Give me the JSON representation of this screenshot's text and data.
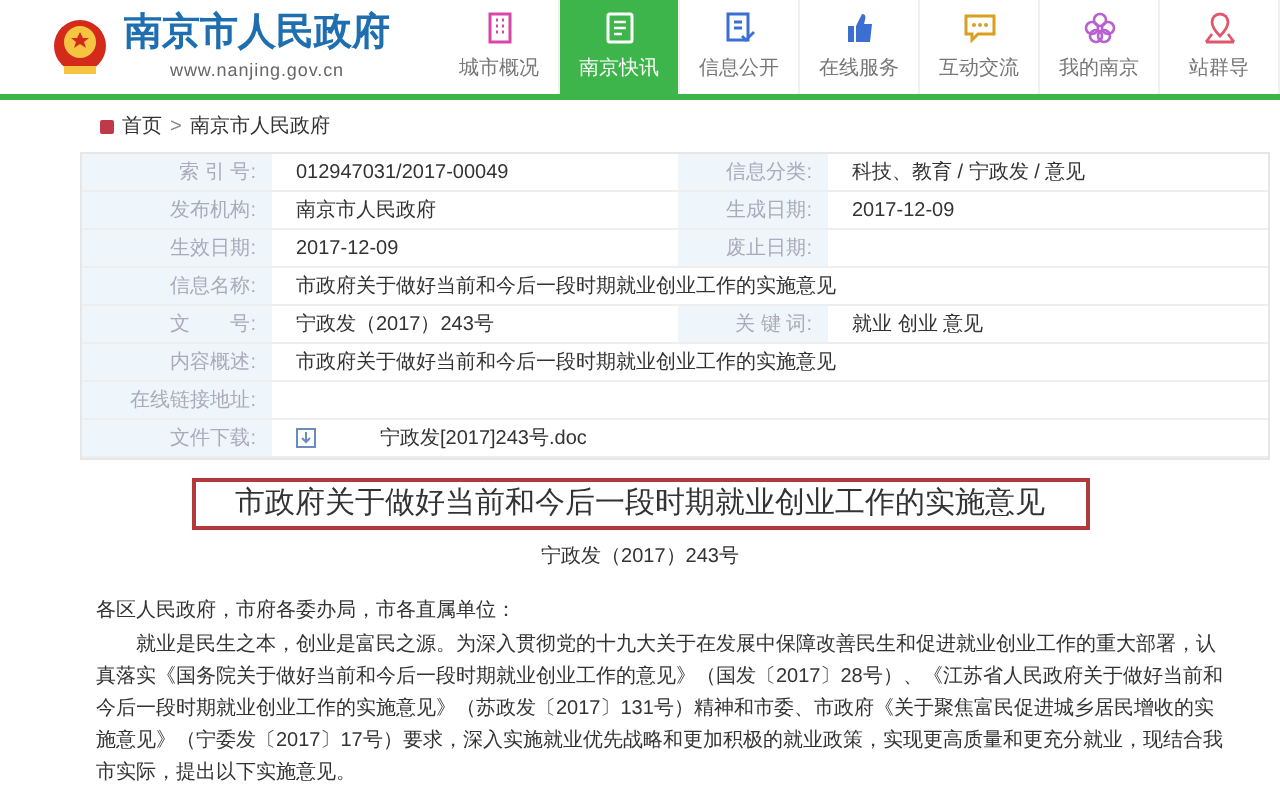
{
  "header": {
    "site_title": "南京市人民政府",
    "site_url": "www.nanjing.gov.cn"
  },
  "nav": [
    {
      "label": "城市概况",
      "selected": false,
      "kind": "buildings"
    },
    {
      "label": "南京快讯",
      "selected": true,
      "kind": "news"
    },
    {
      "label": "信息公开",
      "selected": false,
      "kind": "document"
    },
    {
      "label": "在线服务",
      "selected": false,
      "kind": "thumb"
    },
    {
      "label": "互动交流",
      "selected": false,
      "kind": "chat"
    },
    {
      "label": "我的南京",
      "selected": false,
      "kind": "flower"
    },
    {
      "label": "站群导",
      "selected": false,
      "kind": "pin"
    }
  ],
  "breadcrumb": [
    "首页",
    "南京市人民政府"
  ],
  "breadcrumb_separator": ">",
  "info_table": [
    {
      "label": "索 引 号:",
      "value": "012947031/2017-00049",
      "right_label": "信息分类:",
      "right_value": "科技、教育 / 宁政发 / 意见"
    },
    {
      "label": "发布机构:",
      "value": "南京市人民政府",
      "right_label": "生成日期:",
      "right_value": "2017-12-09"
    },
    {
      "label": "生效日期:",
      "value": "2017-12-09",
      "right_label": "废止日期:"
    },
    {
      "label": "信息名称:",
      "value": "市政府关于做好当前和今后一段时期就业创业工作的实施意见"
    },
    {
      "label": "文　　号:",
      "value": "宁政发（2017）243号",
      "right_label": "关 键 词:",
      "right_value": "就业 创业 意见"
    },
    {
      "label": "内容概述:",
      "value": "市政府关于做好当前和今后一段时期就业创业工作的实施意见"
    },
    {
      "label": "在线链接地址:"
    },
    {
      "label": "文件下载:",
      "file": "宁政发[2017]243号.doc"
    }
  ],
  "article": {
    "title": "市政府关于做好当前和今后一段时期就业创业工作的实施意见",
    "doc_number": "宁政发（2017）243号",
    "salutation": "各区人民政府，市府各委办局，市各直属单位：",
    "paragraph": "就业是民生之本，创业是富民之源。为深入贯彻党的十九大关于在发展中保障改善民生和促进就业创业工作的重大部署，认真落实《国务院关于做好当前和今后一段时期就业创业工作的意见》（国发〔2017〕28号）、《江苏省人民政府关于做好当前和今后一段时期就业创业工作的实施意见》（苏政发〔2017〕131号）精神和市委、市政府《关于聚焦富民促进城乡居民增收的实施意见》（宁委发〔2017〕17号）要求，深入实施就业优先战略和更加积极的就业政策，实现更高质量和更充分就业，现结合我市实际，提出以下实施意见。"
  }
}
